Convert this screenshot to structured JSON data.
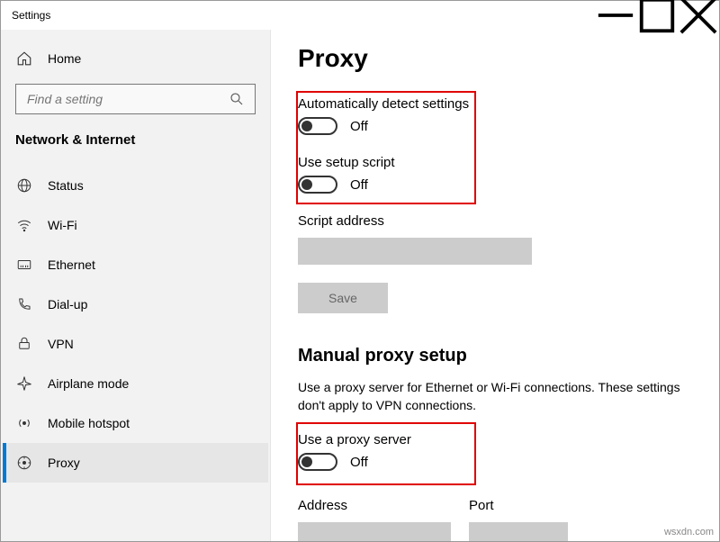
{
  "window": {
    "title": "Settings"
  },
  "sidebar": {
    "home_label": "Home",
    "search_placeholder": "Find a setting",
    "category_header": "Network & Internet",
    "items": [
      {
        "label": "Status"
      },
      {
        "label": "Wi-Fi"
      },
      {
        "label": "Ethernet"
      },
      {
        "label": "Dial-up"
      },
      {
        "label": "VPN"
      },
      {
        "label": "Airplane mode"
      },
      {
        "label": "Mobile hotspot"
      },
      {
        "label": "Proxy"
      }
    ]
  },
  "content": {
    "page_title": "Proxy",
    "auto": {
      "detect_label": "Automatically detect settings",
      "detect_state": "Off",
      "script_label": "Use setup script",
      "script_state": "Off",
      "script_address_label": "Script address",
      "save_label": "Save"
    },
    "manual": {
      "section_title": "Manual proxy setup",
      "description": "Use a proxy server for Ethernet or Wi-Fi connections. These settings don't apply to VPN connections.",
      "use_proxy_label": "Use a proxy server",
      "use_proxy_state": "Off",
      "address_label": "Address",
      "port_label": "Port"
    }
  },
  "watermark": "wsxdn.com"
}
